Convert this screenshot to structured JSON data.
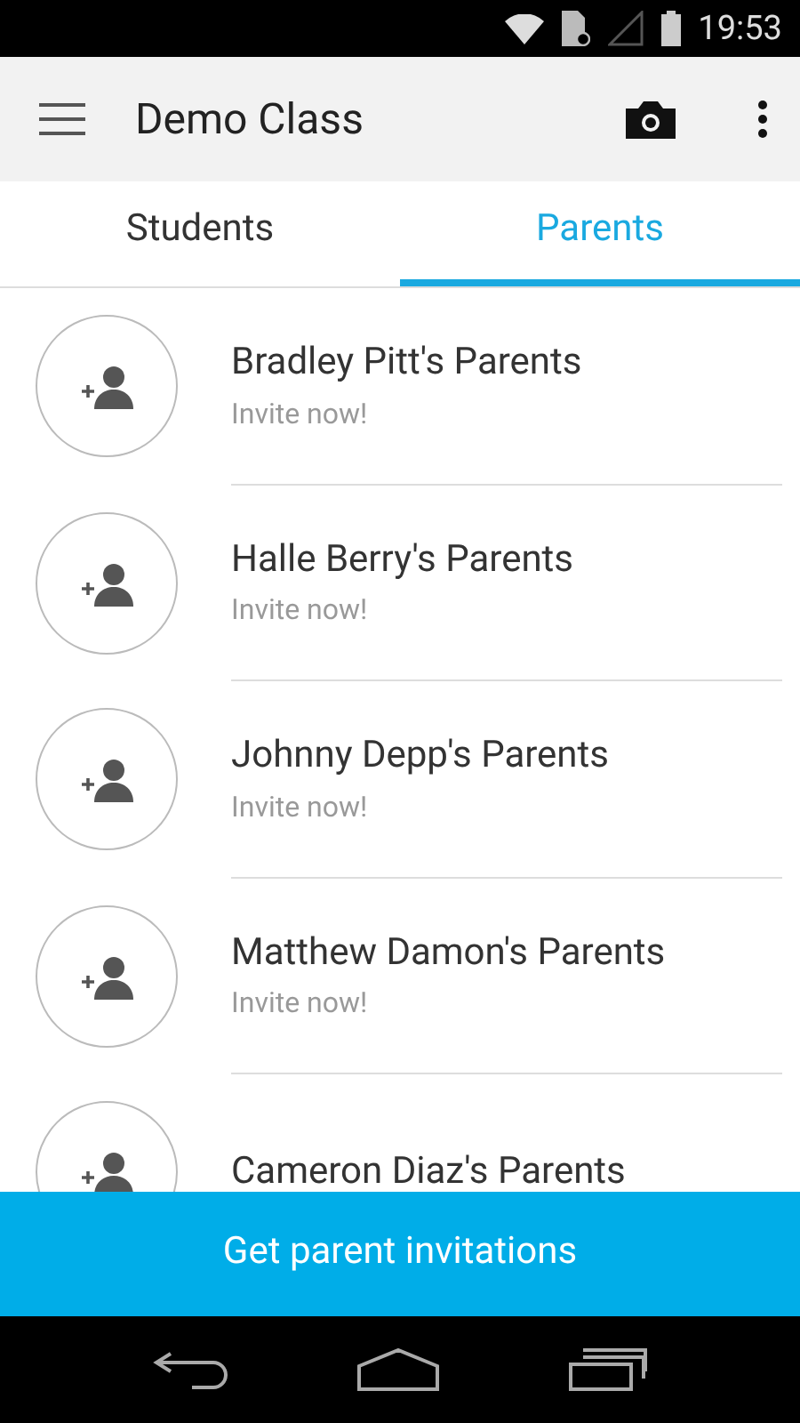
{
  "status_bar": {
    "time": "19:53"
  },
  "app_bar": {
    "title": "Demo Class"
  },
  "tabs": [
    {
      "label": "Students",
      "selected": false
    },
    {
      "label": "Parents",
      "selected": true
    }
  ],
  "parents": [
    {
      "name": "Bradley Pitt's Parents",
      "subtitle": "Invite now!"
    },
    {
      "name": "Halle Berry's Parents",
      "subtitle": "Invite now!"
    },
    {
      "name": "Johnny Depp's Parents",
      "subtitle": "Invite now!"
    },
    {
      "name": "Matthew Damon's Parents",
      "subtitle": "Invite now!"
    },
    {
      "name": "Cameron Diaz's Parents"
    }
  ],
  "action_button": {
    "label": "Get parent invitations"
  }
}
